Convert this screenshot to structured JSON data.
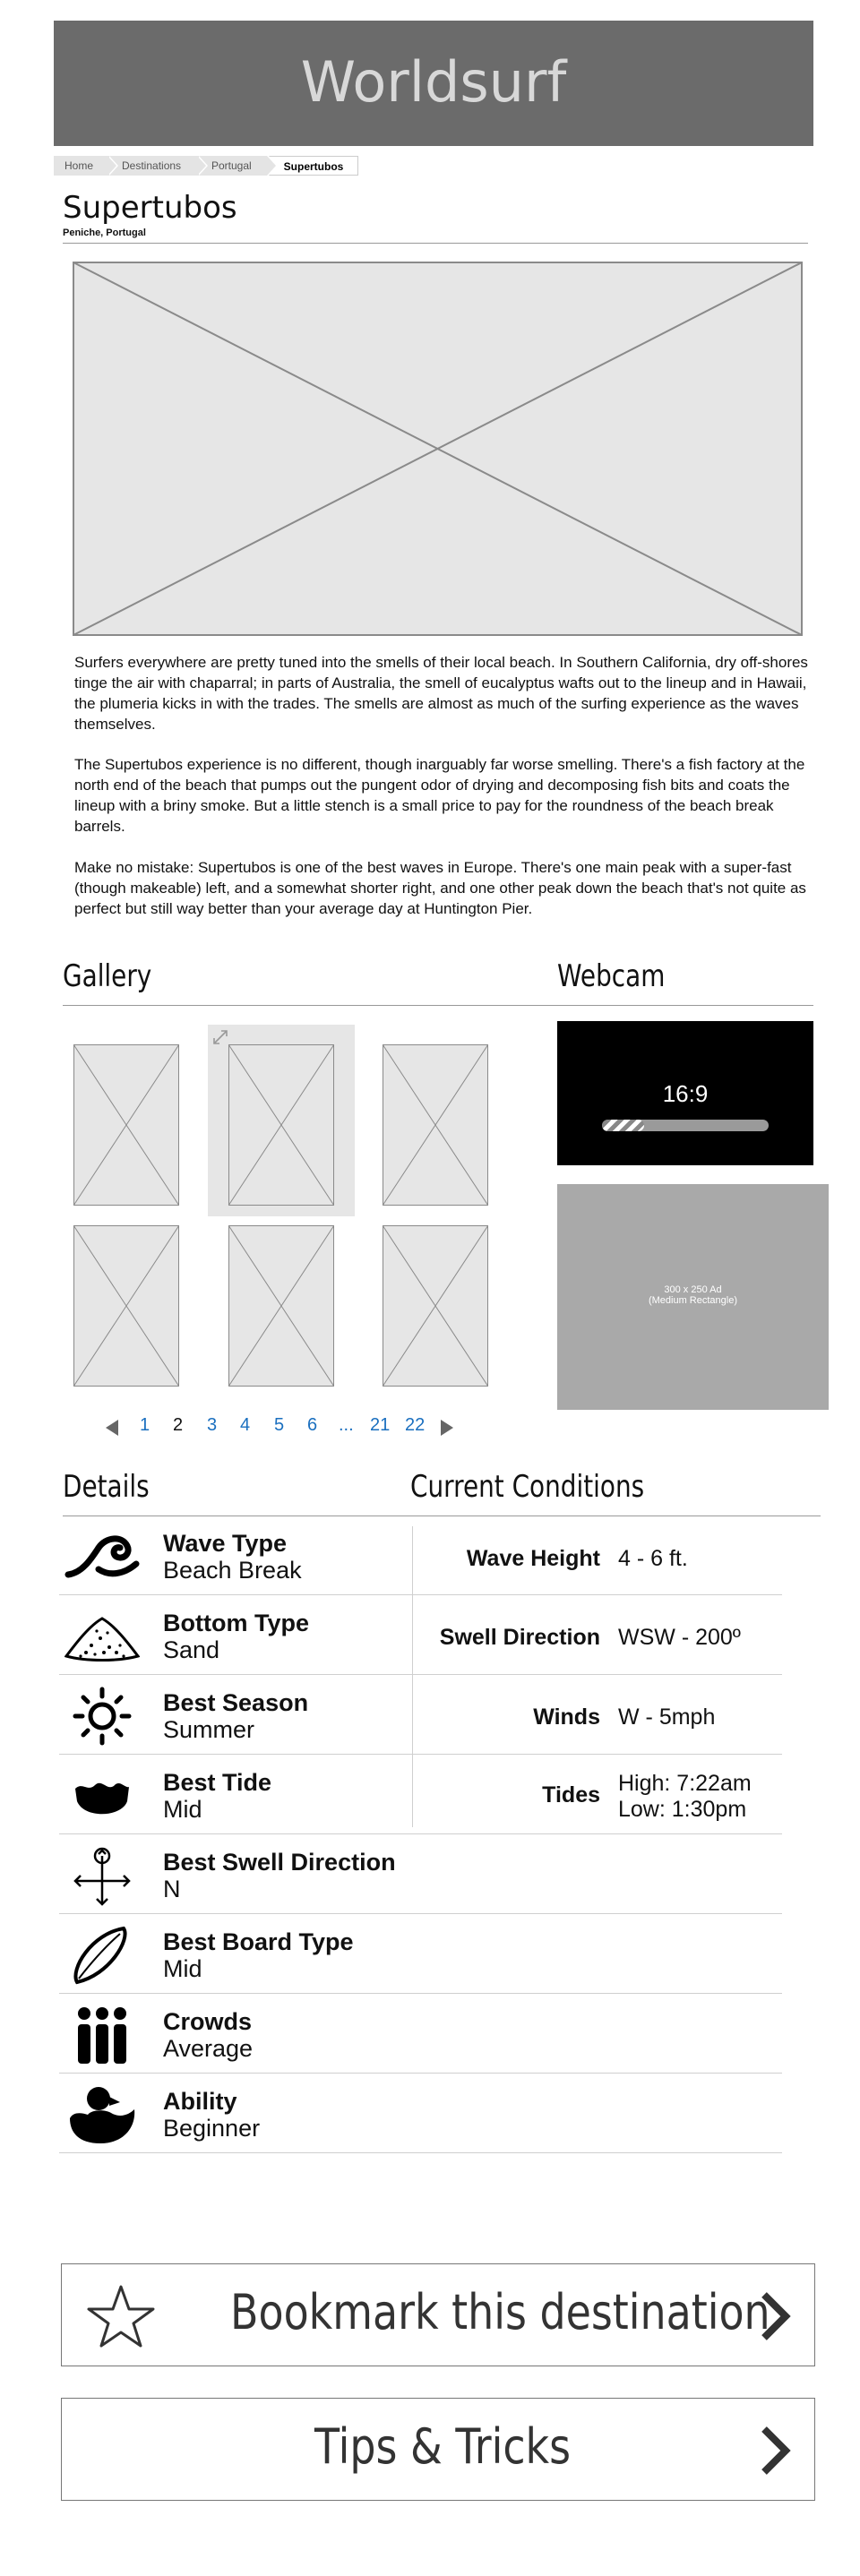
{
  "site": {
    "title": "Worldsurf"
  },
  "breadcrumb": [
    "Home",
    "Destinations",
    "Portugal",
    "Supertubos"
  ],
  "page": {
    "title": "Supertubos",
    "location": "Peniche, Portugal"
  },
  "description": [
    "Surfers everywhere are pretty tuned into the smells of their local beach. In Southern California, dry off-shores tinge the air with chaparral; in parts of Australia, the smell of eucalyptus wafts out to the lineup and in Hawaii, the plumeria kicks in with the trades. The smells are almost as much of the surfing experience as the waves themselves.",
    "The Supertubos experience is no different, though inarguably far worse smelling. There's a fish factory at the north end of the beach that pumps out the pungent odor of drying and decomposing fish bits and coats the lineup with a briny smoke. But a little stench is a small price to pay for the roundness of the beach break barrels.",
    "Make no mistake: Supertubos is one of the best waves in Europe. There's one main peak with a super-fast (though makeable) left, and a somewhat shorter right, and one other peak down the beach that's not quite as perfect but still way better than your average day at Huntington Pier."
  ],
  "gallery": {
    "heading": "Gallery",
    "pagination": {
      "pages": [
        "1",
        "2",
        "3",
        "4",
        "5",
        "6",
        "...",
        "21",
        "22"
      ],
      "current": "2"
    }
  },
  "webcam": {
    "heading": "Webcam",
    "aspect": "16:9",
    "progress": 0.25
  },
  "ad": {
    "line1": "300 x 250 Ad",
    "line2": "(Medium Rectangle)"
  },
  "details": {
    "heading": "Details",
    "items": [
      {
        "label": "Wave Type",
        "value": "Beach Break",
        "icon": "wave-icon"
      },
      {
        "label": "Bottom Type",
        "value": "Sand",
        "icon": "sand-pile-icon"
      },
      {
        "label": "Best Season",
        "value": "Summer",
        "icon": "sun-icon"
      },
      {
        "label": "Best Tide",
        "value": "Mid",
        "icon": "tide-bowl-icon"
      },
      {
        "label": "Best Swell Direction",
        "value": "N",
        "icon": "compass-arrows-icon"
      },
      {
        "label": "Best Board Type",
        "value": "Mid",
        "icon": "surfboard-icon"
      },
      {
        "label": "Crowds",
        "value": "Average",
        "icon": "crowd-icon"
      },
      {
        "label": "Ability",
        "value": "Beginner",
        "icon": "duck-icon"
      }
    ]
  },
  "conditions": {
    "heading": "Current Conditions",
    "items": [
      {
        "label": "Wave Height",
        "value": "4 - 6 ft."
      },
      {
        "label": "Swell Direction",
        "value": "WSW - 200º"
      },
      {
        "label": "Winds",
        "value": "W - 5mph"
      },
      {
        "label": "Tides",
        "value": "High: 7:22am",
        "value2": "Low: 1:30pm"
      }
    ]
  },
  "actions": {
    "bookmark_label": "Bookmark this destination",
    "tips_label": "Tips & Tricks"
  }
}
